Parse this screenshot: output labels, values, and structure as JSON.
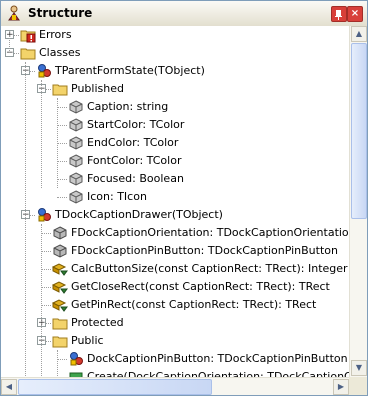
{
  "window": {
    "title": "Structure"
  },
  "tree": [
    {
      "label": "Errors",
      "icon": "error-folder-icon",
      "level": 0,
      "expander": "+"
    },
    {
      "label": "Classes",
      "icon": "folder-icon",
      "level": 0,
      "expander": "-"
    },
    {
      "label": "TParentFormState(TObject)",
      "icon": "class-icon",
      "level": 1,
      "expander": "-"
    },
    {
      "label": "Published",
      "icon": "folder-icon",
      "level": 2,
      "expander": "-"
    },
    {
      "label": "Caption: string",
      "icon": "property-icon",
      "level": 3
    },
    {
      "label": "StartColor: TColor",
      "icon": "property-icon",
      "level": 3
    },
    {
      "label": "EndColor: TColor",
      "icon": "property-icon",
      "level": 3
    },
    {
      "label": "FontColor: TColor",
      "icon": "property-icon",
      "level": 3
    },
    {
      "label": "Focused: Boolean",
      "icon": "property-icon",
      "level": 3
    },
    {
      "label": "Icon: TIcon",
      "icon": "property-icon",
      "level": 3
    },
    {
      "label": "TDockCaptionDrawer(TObject)",
      "icon": "class-icon",
      "level": 1,
      "expander": "-"
    },
    {
      "label": "FDockCaptionOrientation: TDockCaptionOrientation",
      "icon": "field-icon",
      "level": 2
    },
    {
      "label": "FDockCaptionPinButton: TDockCaptionPinButton",
      "icon": "field-icon",
      "level": 2
    },
    {
      "label": "CalcButtonSize(const CaptionRect: TRect): Integer",
      "icon": "method-icon",
      "level": 2
    },
    {
      "label": "GetCloseRect(const CaptionRect: TRect): TRect",
      "icon": "method-icon",
      "level": 2
    },
    {
      "label": "GetPinRect(const CaptionRect: TRect): TRect",
      "icon": "method-icon",
      "level": 2
    },
    {
      "label": "Protected",
      "icon": "folder-icon",
      "level": 2,
      "expander": "+"
    },
    {
      "label": "Public",
      "icon": "folder-icon",
      "level": 2,
      "expander": "-"
    },
    {
      "label": "DockCaptionPinButton: TDockCaptionPinButton",
      "icon": "class-member-icon",
      "level": 3
    },
    {
      "label": "Create(DockCaptionOrientation: TDockCaptionOrientation",
      "icon": "constructor-icon",
      "level": 3
    }
  ],
  "colors": {
    "error": "#d0281e",
    "folder": "#f3d36a",
    "class": "#3a6fd1",
    "method": "#e0b020"
  }
}
